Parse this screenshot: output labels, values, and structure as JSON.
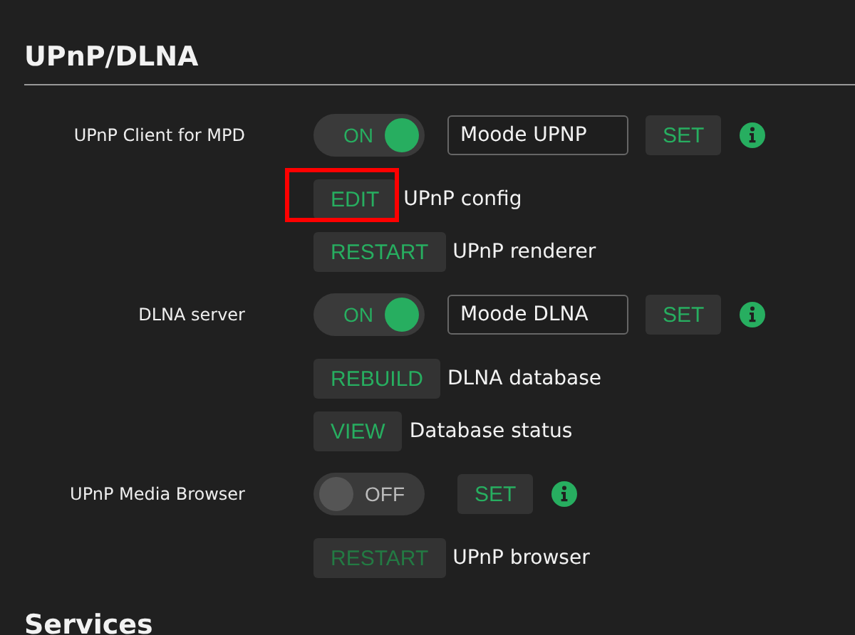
{
  "section": {
    "title": "UPnP/DLNA"
  },
  "rows": [
    {
      "kind": "toggle",
      "label": "UPnP Client for MPD",
      "on": true,
      "toggle_text": "ON",
      "field_value": "Moode UPNP",
      "button": "SET"
    },
    {
      "kind": "action",
      "button": "EDIT",
      "text": "UPnP config",
      "highlighted": true,
      "disabled": false
    },
    {
      "kind": "action",
      "button": "RESTART",
      "text": "UPnP renderer",
      "highlighted": false,
      "disabled": false
    },
    {
      "kind": "toggle",
      "label": "DLNA server",
      "on": true,
      "toggle_text": "ON",
      "field_value": "Moode DLNA",
      "button": "SET"
    },
    {
      "kind": "action",
      "button": "REBUILD",
      "text": "DLNA database",
      "highlighted": false,
      "disabled": false
    },
    {
      "kind": "action",
      "button": "VIEW",
      "text": "Database status",
      "highlighted": false,
      "disabled": false
    },
    {
      "kind": "toggle",
      "label": "UPnP Media Browser",
      "on": false,
      "toggle_text": "OFF",
      "button": "SET"
    },
    {
      "kind": "action",
      "button": "RESTART",
      "text": "UPnP browser",
      "highlighted": false,
      "disabled": true
    }
  ],
  "next_section": {
    "title": "Services"
  }
}
